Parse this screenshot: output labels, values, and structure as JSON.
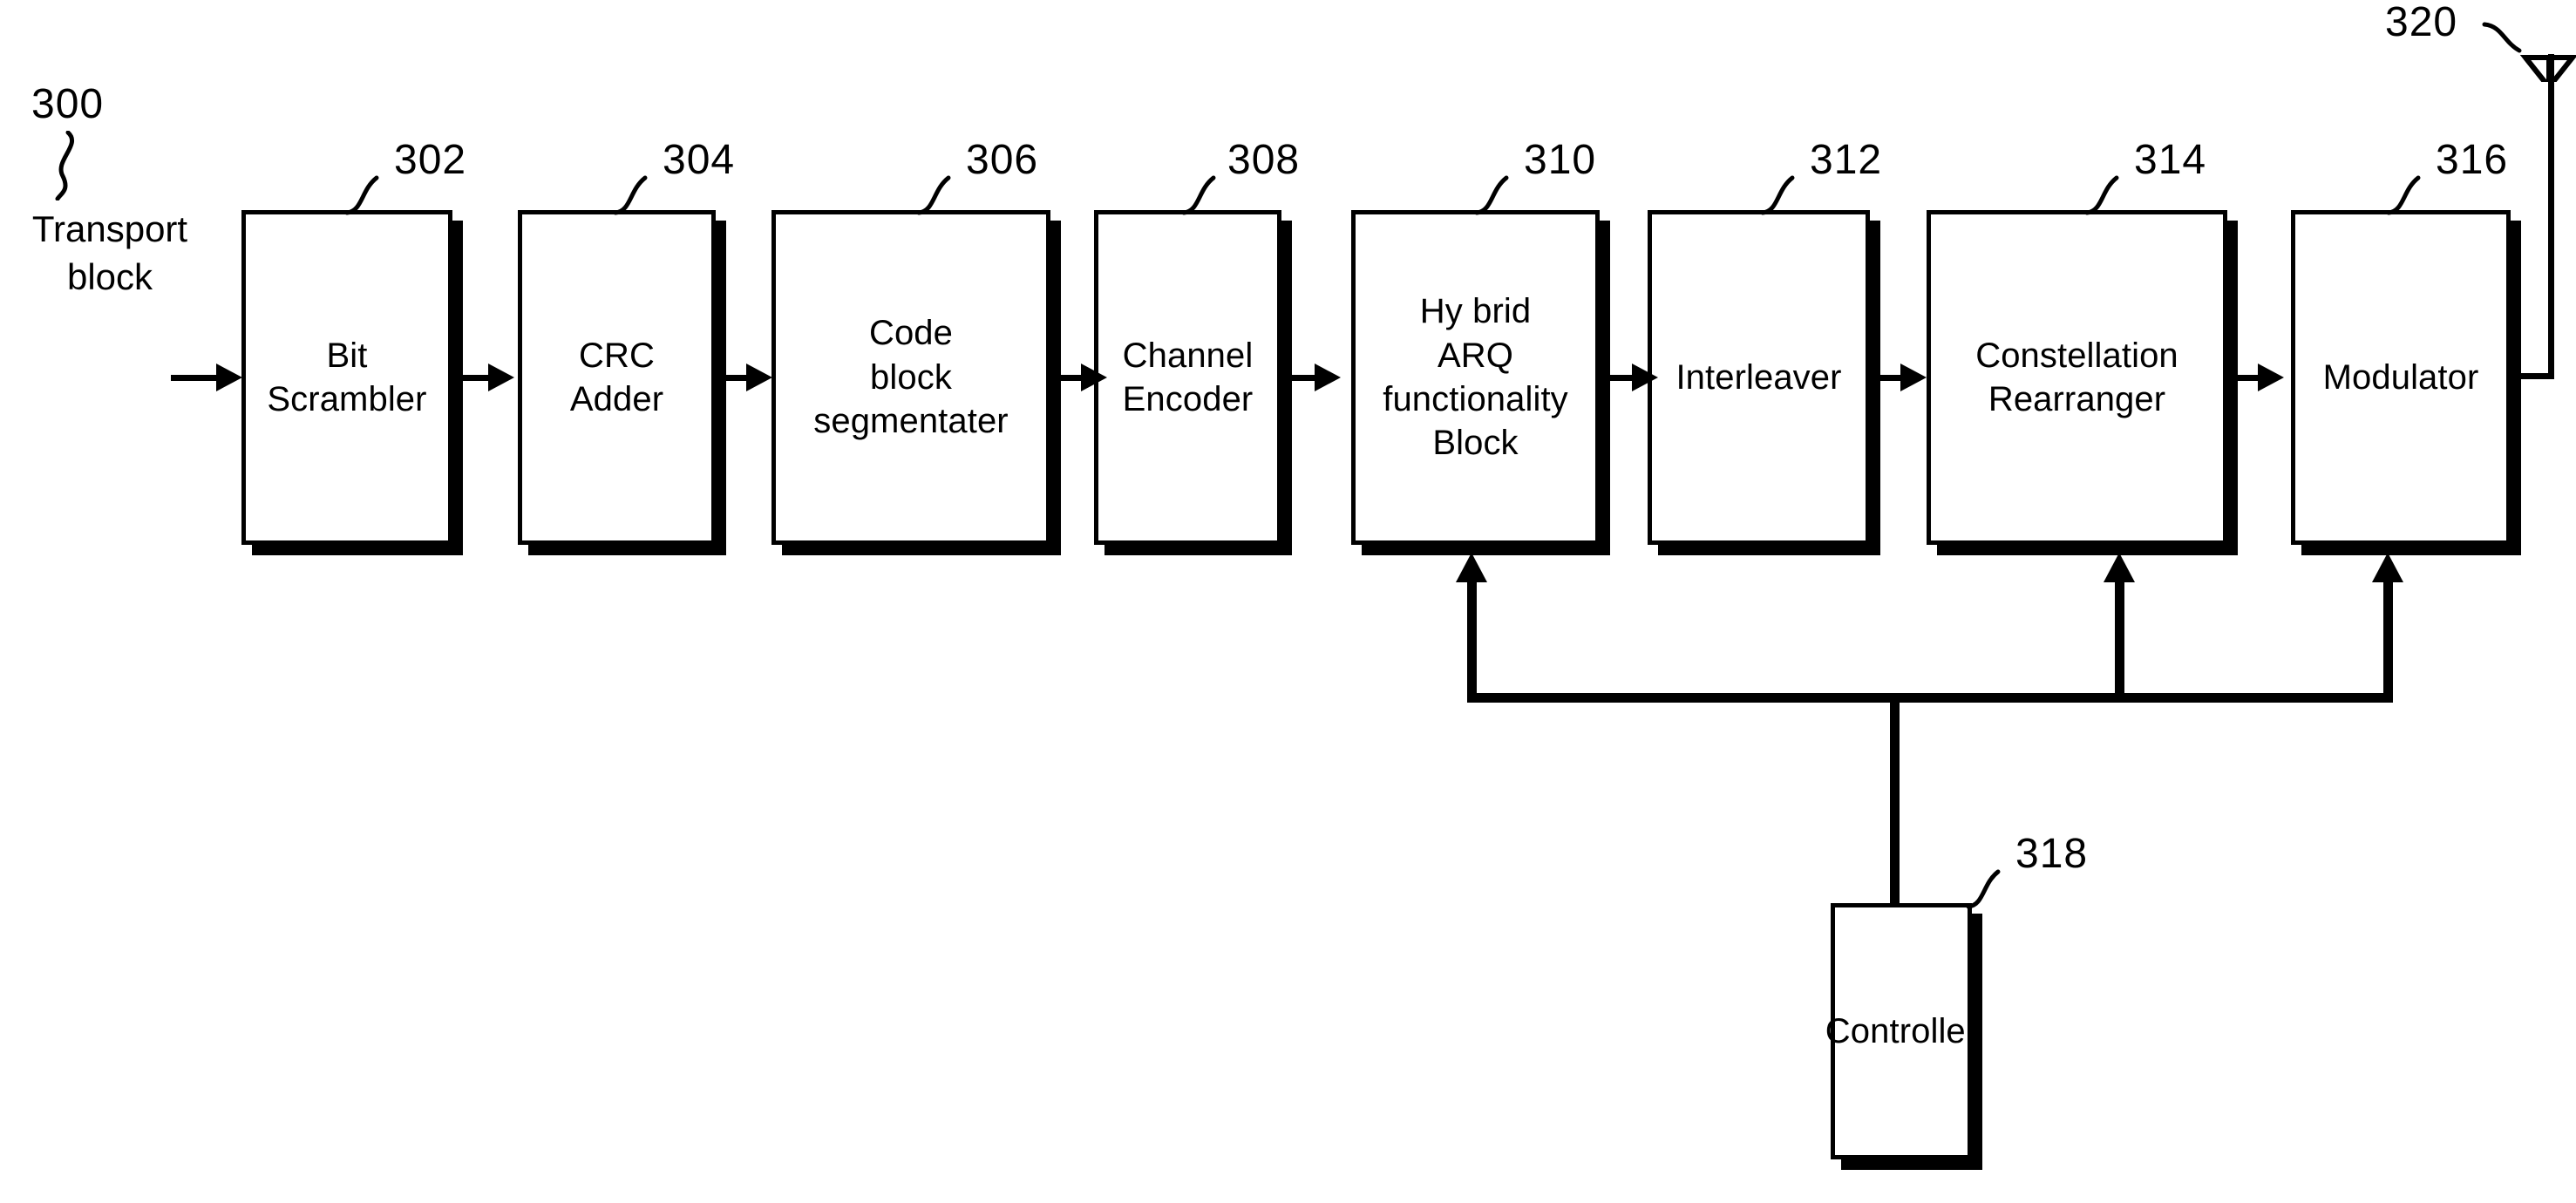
{
  "figure": {
    "type": "patent-block-diagram",
    "description": "Transmitter chain block diagram"
  },
  "input": {
    "ref": "300",
    "label": "Transport\nblock"
  },
  "blocks": [
    {
      "ref": "302",
      "label": "Bit\nScrambler",
      "name": "bit-scrambler"
    },
    {
      "ref": "304",
      "label": "CRC\nAdder",
      "name": "crc-adder"
    },
    {
      "ref": "306",
      "label": "Code\nblock\nsegmentater",
      "name": "code-block-segmentater"
    },
    {
      "ref": "308",
      "label": "Channel\nEncoder",
      "name": "channel-encoder"
    },
    {
      "ref": "310",
      "label": "Hy brid\nARQ\nfunctionality\nBlock",
      "name": "hybrid-arq-functionality-block"
    },
    {
      "ref": "312",
      "label": "Interleaver",
      "name": "interleaver"
    },
    {
      "ref": "314",
      "label": "Constellation\nRearranger",
      "name": "constellation-rearranger"
    },
    {
      "ref": "316",
      "label": "Modulator",
      "name": "modulator"
    }
  ],
  "controller": {
    "ref": "318",
    "label": "Controller"
  },
  "antenna": {
    "ref": "320",
    "label": ""
  },
  "colors": {
    "stroke": "#000000",
    "background": "#ffffff"
  }
}
